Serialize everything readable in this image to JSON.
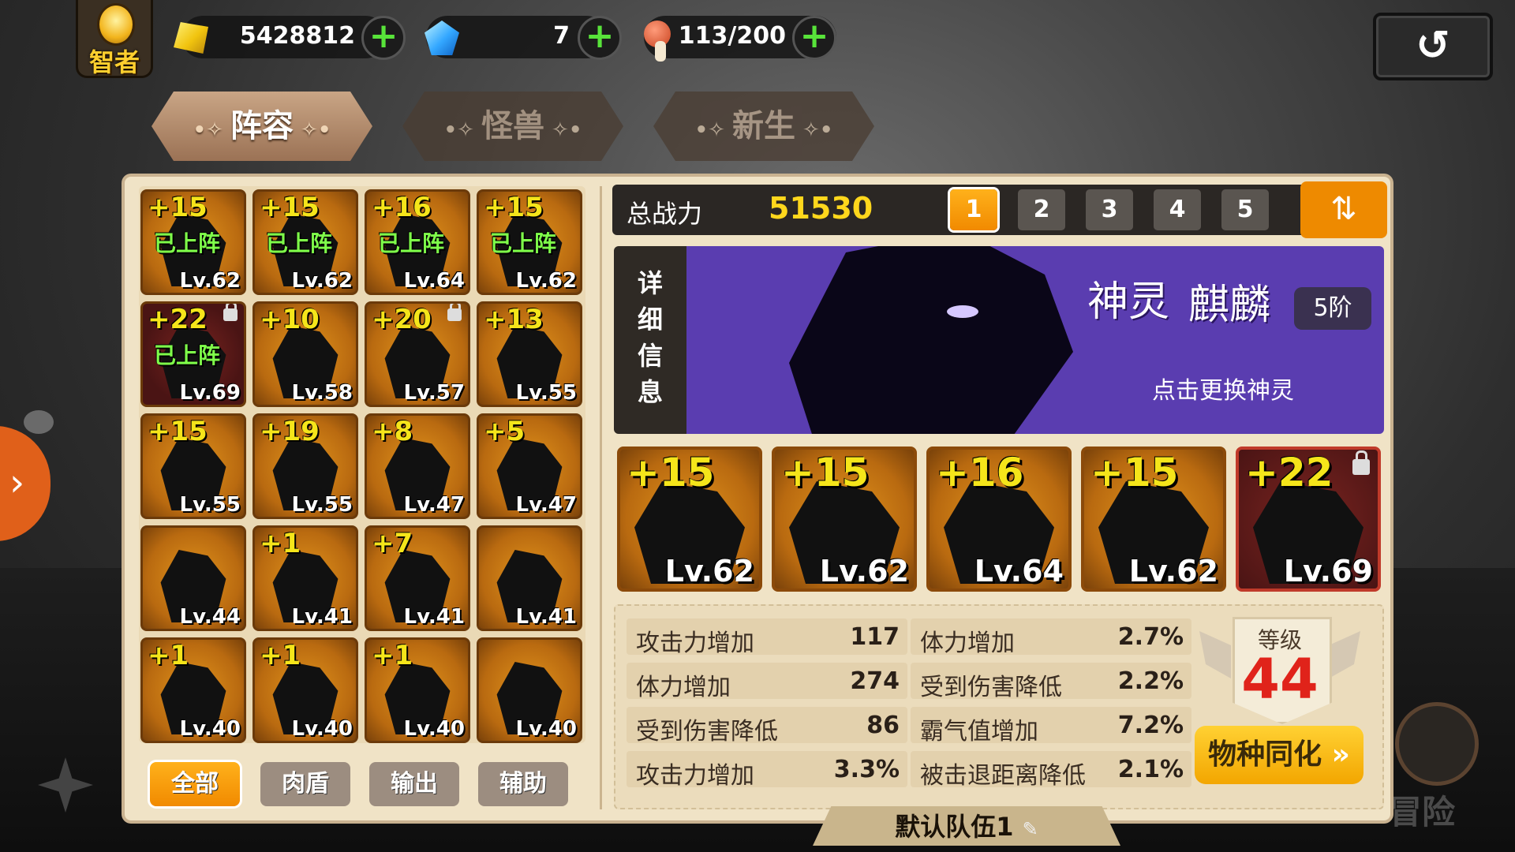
{
  "top_bar": {
    "player_title": "智者",
    "gold": "5428812",
    "gems": "7",
    "stamina": "113/200",
    "plus_symbol": "+",
    "back_icon": "back-arrow-icon"
  },
  "tabs": [
    {
      "label": "阵容",
      "active": true
    },
    {
      "label": "怪兽",
      "active": false
    },
    {
      "label": "新生",
      "active": false
    }
  ],
  "roster": [
    {
      "plus": "+15",
      "level": "Lv.62",
      "status": "已上阵",
      "locked": false
    },
    {
      "plus": "+15",
      "level": "Lv.62",
      "status": "已上阵",
      "locked": false
    },
    {
      "plus": "+16",
      "level": "Lv.64",
      "status": "已上阵",
      "locked": false
    },
    {
      "plus": "+15",
      "level": "Lv.62",
      "status": "已上阵",
      "locked": false
    },
    {
      "plus": "+22",
      "level": "Lv.69",
      "status": "已上阵",
      "locked": true
    },
    {
      "plus": "+10",
      "level": "Lv.58",
      "status": "",
      "locked": false
    },
    {
      "plus": "+20",
      "level": "Lv.57",
      "status": "",
      "locked": true
    },
    {
      "plus": "+13",
      "level": "Lv.55",
      "status": "",
      "locked": false
    },
    {
      "plus": "+15",
      "level": "Lv.55",
      "status": "",
      "locked": false
    },
    {
      "plus": "+19",
      "level": "Lv.55",
      "status": "",
      "locked": false
    },
    {
      "plus": "+8",
      "level": "Lv.47",
      "status": "",
      "locked": false
    },
    {
      "plus": "+5",
      "level": "Lv.47",
      "status": "",
      "locked": false
    },
    {
      "plus": "",
      "level": "Lv.44",
      "status": "",
      "locked": false
    },
    {
      "plus": "+1",
      "level": "Lv.41",
      "status": "",
      "locked": false
    },
    {
      "plus": "+7",
      "level": "Lv.41",
      "status": "",
      "locked": false
    },
    {
      "plus": "",
      "level": "Lv.41",
      "status": "",
      "locked": false
    },
    {
      "plus": "+1",
      "level": "Lv.40",
      "status": "",
      "locked": false
    },
    {
      "plus": "+1",
      "level": "Lv.40",
      "status": "",
      "locked": false
    },
    {
      "plus": "+1",
      "level": "Lv.40",
      "status": "",
      "locked": false
    },
    {
      "plus": "",
      "level": "Lv.40",
      "status": "",
      "locked": false
    }
  ],
  "filters": [
    {
      "label": "全部",
      "active": true
    },
    {
      "label": "肉盾",
      "active": false
    },
    {
      "label": "输出",
      "active": false
    },
    {
      "label": "辅助",
      "active": false
    }
  ],
  "power": {
    "label": "总战力",
    "value": "51530"
  },
  "team_tabs": [
    "1",
    "2",
    "3",
    "4",
    "5"
  ],
  "active_team_tab": "1",
  "detail_tab": [
    "详",
    "细",
    "信",
    "息"
  ],
  "god": {
    "prefix": "神灵",
    "name": "麒麟",
    "tier": "5阶",
    "hint": "点击更换神灵"
  },
  "team": [
    {
      "plus": "+15",
      "level": "Lv.62",
      "locked": false
    },
    {
      "plus": "+15",
      "level": "Lv.62",
      "locked": false
    },
    {
      "plus": "+16",
      "level": "Lv.64",
      "locked": false
    },
    {
      "plus": "+15",
      "level": "Lv.62",
      "locked": false
    },
    {
      "plus": "+22",
      "level": "Lv.69",
      "locked": true
    }
  ],
  "stats_left": [
    {
      "name": "攻击力增加",
      "value": "117"
    },
    {
      "name": "体力增加",
      "value": "274"
    },
    {
      "name": "受到伤害降低",
      "value": "86"
    },
    {
      "name": "攻击力增加",
      "value": "3.3%"
    }
  ],
  "stats_right": [
    {
      "name": "体力增加",
      "value": "2.7%"
    },
    {
      "name": "受到伤害降低",
      "value": "2.2%"
    },
    {
      "name": "霸气值增加",
      "value": "7.2%"
    },
    {
      "name": "被击退距离降低",
      "value": "2.1%"
    }
  ],
  "level": {
    "label": "等级",
    "value": "44"
  },
  "species_button": "物种同化",
  "team_name": "默认队伍1",
  "side_label": "冒险"
}
